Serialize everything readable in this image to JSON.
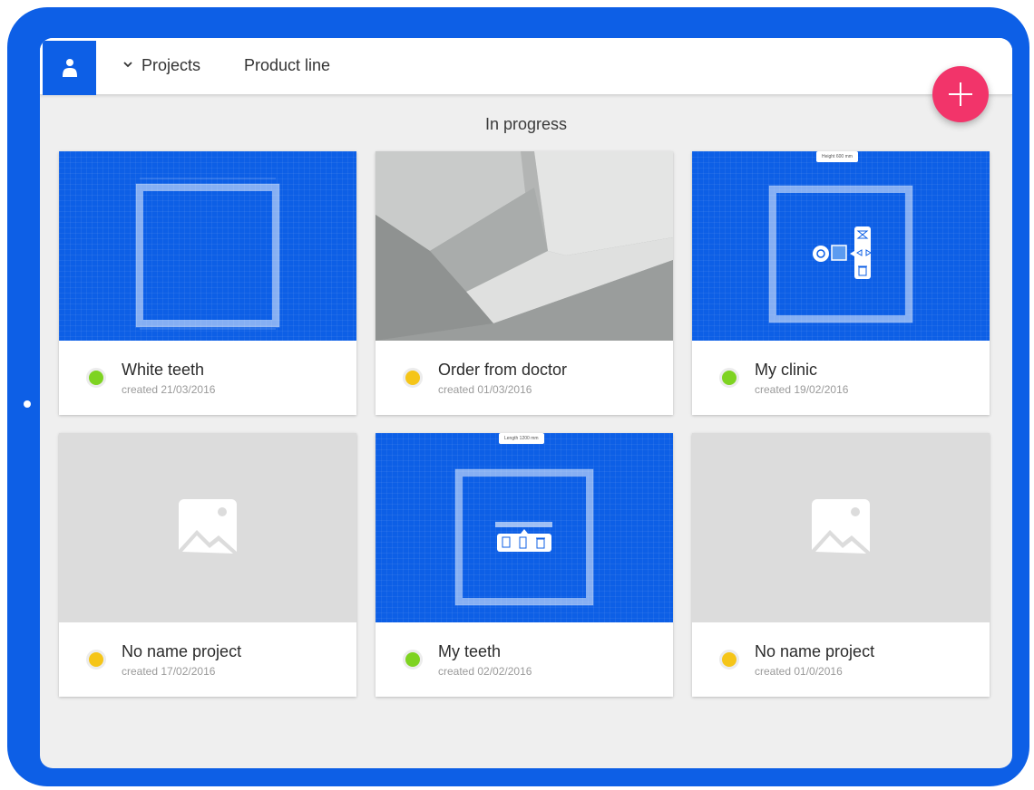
{
  "nav": {
    "projects_label": "Projects",
    "product_line_label": "Product line"
  },
  "section_title": "In progress",
  "colors": {
    "brand_blue": "#0d5fe6",
    "fab_pink": "#f2346a",
    "status_green": "#7ed321",
    "status_yellow": "#f5c518"
  },
  "projects": [
    {
      "title": "White teeth",
      "date": "created 21/03/2016",
      "status": "green",
      "thumbnail": "blueprint"
    },
    {
      "title": "Order from doctor",
      "date": "created 01/03/2016",
      "status": "yellow",
      "thumbnail": "3d-render"
    },
    {
      "title": "My clinic",
      "date": "created 19/02/2016",
      "status": "green",
      "thumbnail": "blueprint-edit",
      "overlay_label": "Height 600 mm"
    },
    {
      "title": "No name project",
      "date": "created 17/02/2016",
      "status": "yellow",
      "thumbnail": "image-placeholder-icon"
    },
    {
      "title": "My teeth",
      "date": "created 02/02/2016",
      "status": "green",
      "thumbnail": "blueprint-edit",
      "overlay_label": "Length 1200 mm"
    },
    {
      "title": "No name project",
      "date": "created 01/0/2016",
      "status": "yellow",
      "thumbnail": "image-placeholder-icon"
    }
  ]
}
